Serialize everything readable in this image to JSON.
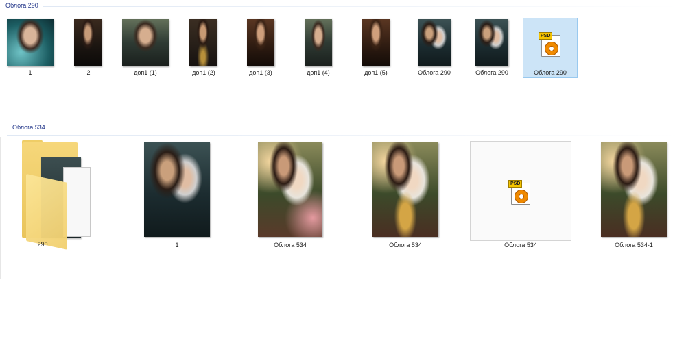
{
  "groups": [
    {
      "header": "Облога 290",
      "items": [
        {
          "label": "1",
          "type": "image",
          "art": "teal"
        },
        {
          "label": "2",
          "type": "image",
          "art": "dark"
        },
        {
          "label": "доп1 (1)",
          "type": "image",
          "art": "greenish"
        },
        {
          "label": "доп1 (2)",
          "type": "image",
          "art": "darkgold"
        },
        {
          "label": "доп1 (3)",
          "type": "image",
          "art": "brownwarm"
        },
        {
          "label": "доп1 (4)",
          "type": "image",
          "art": "greenish"
        },
        {
          "label": "доп1 (5)",
          "type": "image",
          "art": "brownwarm"
        },
        {
          "label": "Облога  290",
          "type": "image",
          "art": "couple"
        },
        {
          "label": "Облога 290",
          "type": "image",
          "art": "couple"
        },
        {
          "label": "Облога 290",
          "type": "psd",
          "selected": true
        }
      ]
    },
    {
      "header": "Облога 534",
      "items": [
        {
          "label": "290",
          "type": "folder"
        },
        {
          "label": "1",
          "type": "image",
          "art": "couple"
        },
        {
          "label": "Облога  534",
          "type": "image",
          "art": "floral"
        },
        {
          "label": "Облога 534",
          "type": "image",
          "art": "floraltitle"
        },
        {
          "label": "Облога 534",
          "type": "psd"
        },
        {
          "label": "Облога 534-1",
          "type": "image",
          "art": "floraltitle"
        }
      ]
    }
  ],
  "icons": {
    "psd_badge": "PSD",
    "folder": "folder-icon",
    "psd": "psd-file-icon"
  }
}
